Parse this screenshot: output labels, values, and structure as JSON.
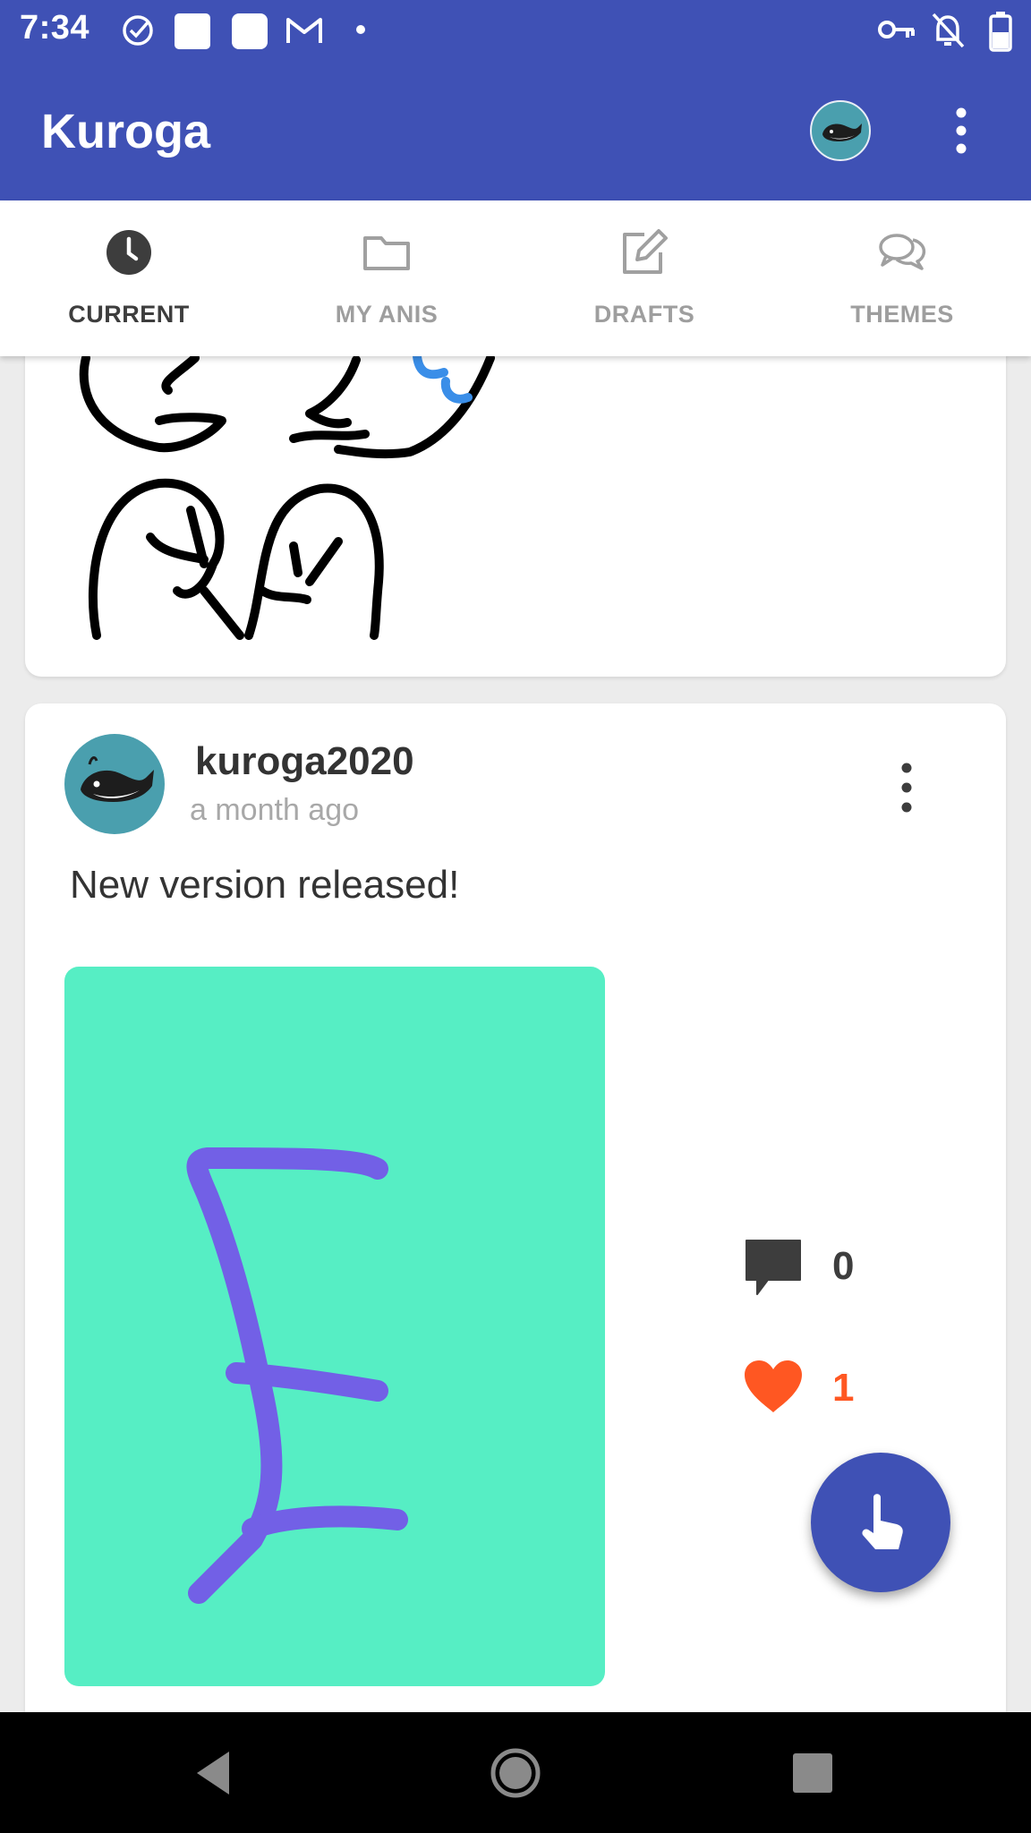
{
  "status_bar": {
    "time": "7:34",
    "left_icons": [
      "check-circle-icon",
      "notification-square-icon",
      "notification-square-icon",
      "gmail-icon",
      "dot-icon"
    ],
    "right_icons": [
      "vpn-key-icon",
      "notifications-off-icon",
      "battery-icon"
    ]
  },
  "app_bar": {
    "title": "Kuroga",
    "background_color": "#3f51b5"
  },
  "tabs": [
    {
      "label": "CURRENT",
      "icon": "clock-icon",
      "active": true
    },
    {
      "label": "MY ANIS",
      "icon": "folder-icon",
      "active": false
    },
    {
      "label": "DRAFTS",
      "icon": "edit-icon",
      "active": false
    },
    {
      "label": "THEMES",
      "icon": "chat-bubbles-icon",
      "active": false
    }
  ],
  "post": {
    "username": "kuroga2020",
    "time": "a month ago",
    "text": "New version released!",
    "comments": "0",
    "likes": "1",
    "drawing_background": "#56eec4",
    "stroke_color": "#7260e6",
    "like_color": "#ff5722"
  },
  "fab": {
    "icon": "touch-hand-icon"
  },
  "nav_bar": {
    "buttons": [
      "back-icon",
      "home-icon",
      "recents-icon"
    ]
  }
}
